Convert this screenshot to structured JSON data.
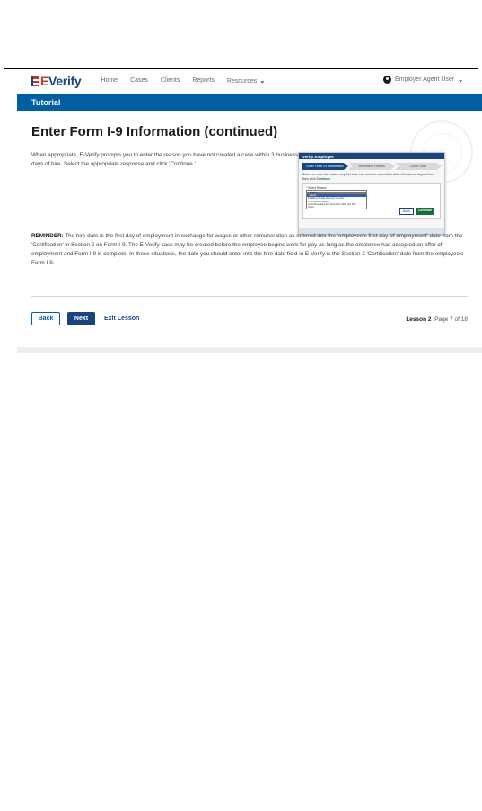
{
  "nav": {
    "logo_e": "E",
    "logo_text": "Verify",
    "links": [
      "Home",
      "Cases",
      "Clients",
      "Reports"
    ],
    "resources_label": "Resources",
    "user_label": "Employer Agent User"
  },
  "tutorial_bar": {
    "title": "Tutorial"
  },
  "main": {
    "heading": "Enter Form I-9 Information (continued)",
    "intro": "When appropriate, E-Verify prompts you to enter the reason you have not created a case within 3 business days of hire. Select the appropriate response and click 'Continue.'",
    "reminder_label": "REMINDER:",
    "reminder_text": " The hire date is the first day of employment in exchange for wages or other remuneration as entered into the 'employee's first day of employment' date from the 'Certification' in Section 2 on Form I-9. The E-Verify case may be created before the employee begins work for pay as long as the employee has accepted an offer of employment and Form I-9 is complete. In these situations, the date you should enter into the hire date field in E-Verify is the Section 2 'Certification' date from the employee's Form I-9."
  },
  "thumbnail": {
    "header": "Verify Employee",
    "steps": [
      "Enter Form I-9 Information",
      "Verification Results",
      "Close Case"
    ],
    "instruction": "Select or enter the reason why this case has not been submitted within 3 business days of hire, then click",
    "instruction_continue": "Continue.",
    "select_label": "Select Reason",
    "select_value": "- select -",
    "options": [
      "- select -",
      "Awaiting Social Security Number",
      "Technical Problems",
      "Audit Revealed that New Hire Was Not Run",
      "Other"
    ],
    "back_label": "Back",
    "continue_label": "Continue"
  },
  "actions": {
    "back": "Back",
    "next": "Next",
    "exit": "Exit Lesson"
  },
  "progress": {
    "lesson_label": "Lesson 2",
    "page_text": "Page 7 of 18"
  },
  "colors": {
    "primary_blue": "#005ea2",
    "dark_blue": "#1a4480",
    "continue_green": "#1a6b3a"
  }
}
